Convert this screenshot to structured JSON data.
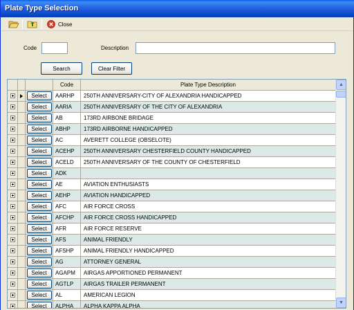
{
  "window": {
    "title": "Plate Type Selection"
  },
  "toolbar": {
    "close_label": "Close"
  },
  "filter": {
    "code_label": "Code",
    "code_value": "",
    "description_label": "Description",
    "description_value": "",
    "search_label": "Search",
    "clear_label": "Clear Filter"
  },
  "grid": {
    "headers": {
      "code": "Code",
      "description": "Plate Type Description"
    },
    "select_label": "Select",
    "rows": [
      {
        "code": "AARHP",
        "description": "250TH ANNIVERSARY-CITY OF ALEXANDRIA HANDICAPPED"
      },
      {
        "code": "AARIA",
        "description": "250TH ANNIVERSARY OF THE CITY OF ALEXANDRIA"
      },
      {
        "code": "AB",
        "description": "173RD AIRBONE BRIDAGE"
      },
      {
        "code": "ABHP",
        "description": "173RD AIRBORNE HANDICAPPED"
      },
      {
        "code": "AC",
        "description": "AVERETT COLLEGE (OBSELOTE)"
      },
      {
        "code": "ACEHP",
        "description": "250TH ANNIVERSARY  CHESTERFIELD COUNTY HANDICAPPED"
      },
      {
        "code": "ACELD",
        "description": "250TH ANNIVERSARY OF THE COUNTY OF CHESTERFIELD"
      },
      {
        "code": "ADK",
        "description": ""
      },
      {
        "code": "AE",
        "description": "AVIATION ENTHUSIASTS"
      },
      {
        "code": "AEHP",
        "description": "AVIATION HANDICAPPED"
      },
      {
        "code": "AFC",
        "description": "AIR FORCE CROSS"
      },
      {
        "code": "AFCHP",
        "description": "AIR FORCE CROSS HANDICAPPED"
      },
      {
        "code": "AFR",
        "description": "AIR FORCE RESERVE"
      },
      {
        "code": "AFS",
        "description": "ANIMAL FRIENDLY"
      },
      {
        "code": "AFSHP",
        "description": "ANIMAL FRIENDLY HANDICAPPED"
      },
      {
        "code": "AG",
        "description": "ATTORNEY GENERAL"
      },
      {
        "code": "AGAPM",
        "description": "AIRGAS APPORTIONED PERMANENT"
      },
      {
        "code": "AGTLP",
        "description": "AIRGAS TRAILER PERMANENT"
      },
      {
        "code": "AL",
        "description": "AMERICAN LEGION"
      },
      {
        "code": "ALPHA",
        "description": "ALPHA KAPPA ALPHA"
      }
    ]
  }
}
